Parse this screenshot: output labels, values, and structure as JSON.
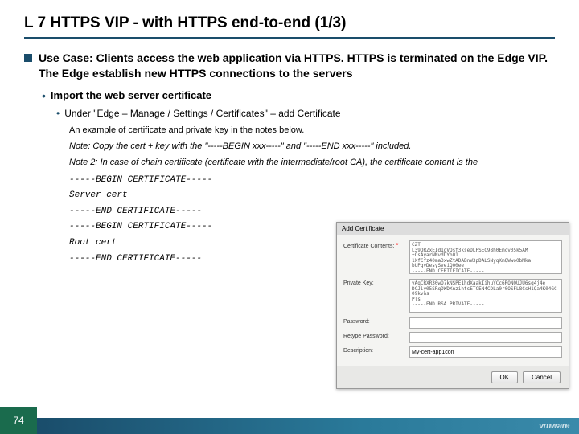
{
  "title": "L 7 HTTPS VIP - with HTTPS end-to-end (1/3)",
  "usecase": "Use Case: Clients access the web application via HTTPS. HTTPS is terminated on the Edge VIP. The Edge establish new HTTPS connections to the servers",
  "sub1": "Import the web server certificate",
  "sub2": "Under \"Edge – Manage /  Settings / Certificates\" – add Certificate",
  "note_example": "An example of certificate and private key in the notes below.",
  "note_copy": "Note: Copy the cert + key with the \"-----BEGIN xxx-----\" and \"-----END xxx-----\" included.",
  "note_chain": "Note 2: In case of chain certificate (certificate with the intermediate/root CA), the certificate content is the",
  "cert_lines": {
    "l1": "-----BEGIN CERTIFICATE-----",
    "l2": "Server cert",
    "l3": "-----END CERTIFICATE-----",
    "l4": "-----BEGIN CERTIFICATE-----",
    "l5": "Root cert",
    "l6": "-----END CERTIFICATE-----"
  },
  "dialog": {
    "title": "Add Certificate",
    "label_contents": "Certificate Contents:",
    "contents_text": "CZT\nL39ORZxEId1gVQsf3kseDLPSEC98h0Emcv05k5AM\n+OsAyarNNvdLYb01\n1XfCfz40ma3xwZtADABnW3pDALSNyqKmQWwo0bMka\nbUPgvDesySveiQ00ee\n-----END CERTIFICATE-----",
    "label_private": "Private Key:",
    "private_text": "vAqCRXR30wO7kNSPE1hdXaakIihuYCc6RON0UJU6sq4j4e\nDCJiy05SRqDWDXnzihtsETCEN4CDLa0r0OSFL8CsH1Qa4K04GC09kvns\nPls\n-----END RSA PRIVATE-----",
    "label_password": "Password:",
    "label_retype": "Retype Password:",
    "label_desc": "Description:",
    "desc_value": "My-cert-app1con",
    "btn_ok": "OK",
    "btn_cancel": "Cancel"
  },
  "page_number": "74",
  "logo": "vmware"
}
